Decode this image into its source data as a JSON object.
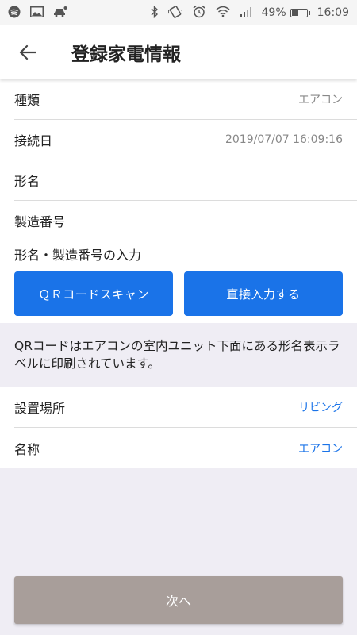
{
  "status_bar": {
    "battery_percent": "49%",
    "battery_level": 0.49,
    "time": "16:09",
    "icons_left": [
      "spotify-icon",
      "image-icon",
      "car-icon"
    ],
    "icons_right": [
      "bluetooth-icon",
      "vibrate-icon",
      "alarm-icon",
      "wifi-icon",
      "signal-icon",
      "battery-icon"
    ]
  },
  "app_bar": {
    "title": "登録家電情報",
    "back_icon": "arrow-left-icon"
  },
  "details": [
    {
      "label": "種類",
      "value": "エアコン"
    },
    {
      "label": "接続日",
      "value": "2019/07/07 16:09:16"
    },
    {
      "label": "形名",
      "value": ""
    },
    {
      "label": "製造番号",
      "value": ""
    }
  ],
  "input_section": {
    "label": "形名・製造番号の入力",
    "qr_button": "ＱＲコードスキャン",
    "direct_button": "直接入力する"
  },
  "info_text": "QRコードはエアコンの室内ユニット下面にある形名表示ラベルに印刷されています。",
  "settings": [
    {
      "label": "設置場所",
      "value": "リビング"
    },
    {
      "label": "名称",
      "value": "エアコン"
    }
  ],
  "next_button": "次へ",
  "colors": {
    "accent": "#1a73e8",
    "next_button": "#a89e9a",
    "background": "#efedf4"
  }
}
